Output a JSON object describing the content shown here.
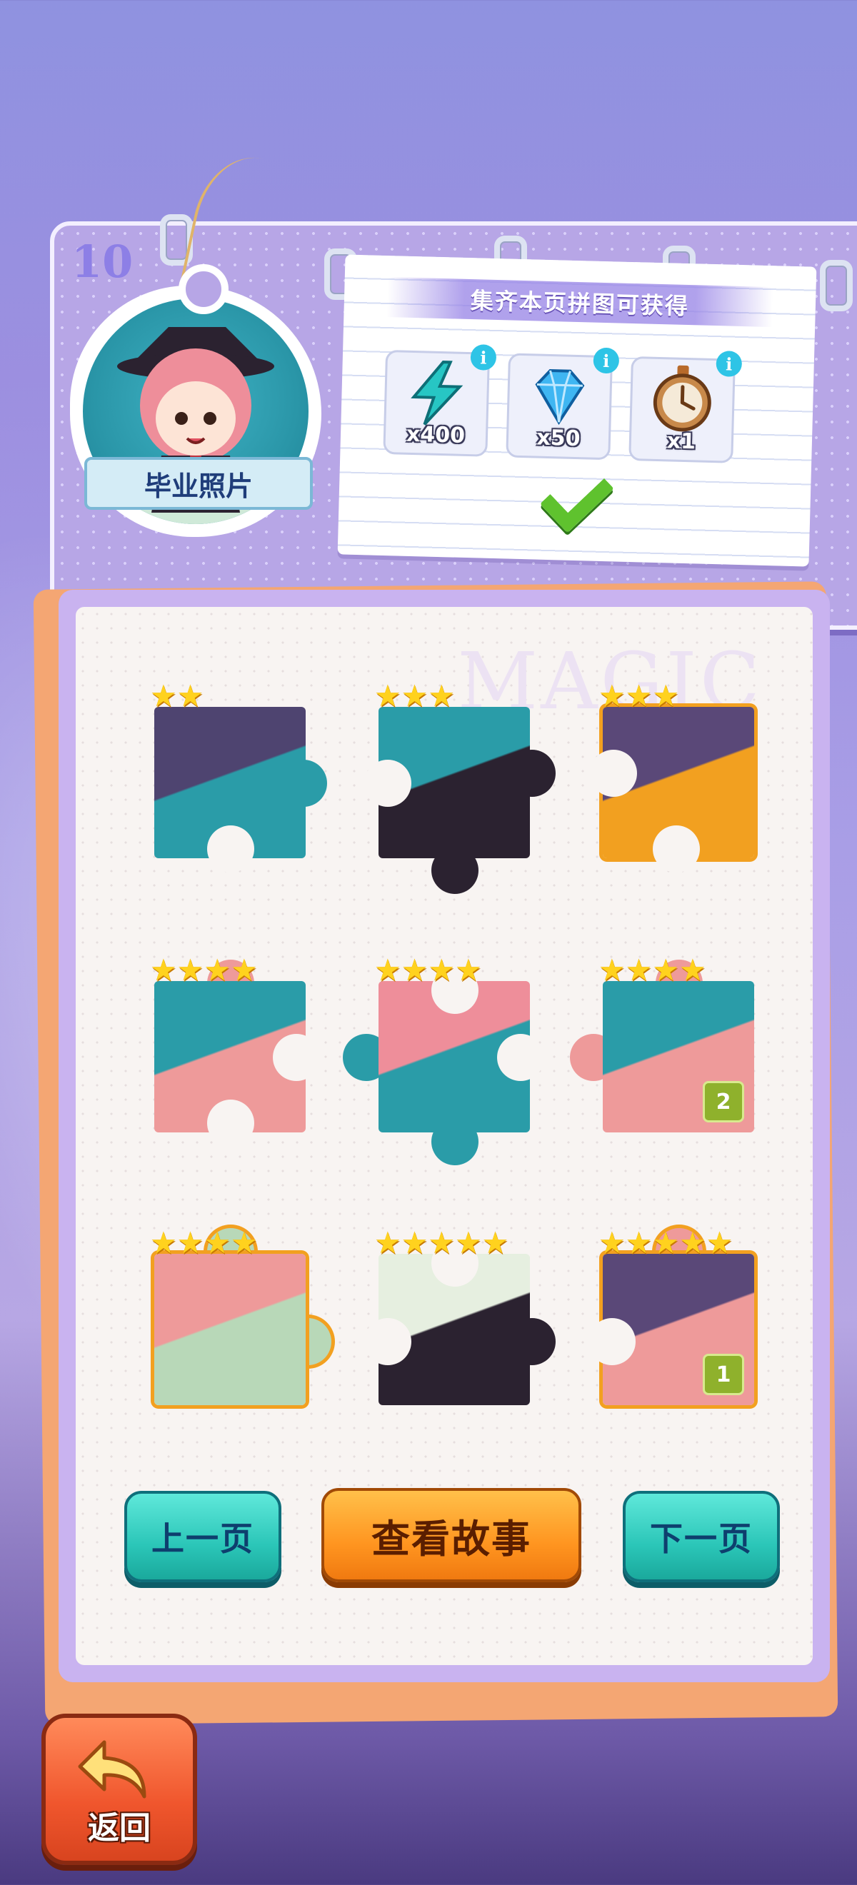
{
  "page": {
    "number": "10",
    "album_title": "毕业照片"
  },
  "reward": {
    "title": "集齐本页拼图可获得",
    "items": [
      {
        "icon": "lightning-icon",
        "count": "x400"
      },
      {
        "icon": "diamond-icon",
        "count": "x50"
      },
      {
        "icon": "stopwatch-icon",
        "count": "x1"
      }
    ],
    "claimed": true,
    "info_glyph": "i"
  },
  "board": {
    "watermark": "MAGIC"
  },
  "pieces": [
    {
      "stars": 2,
      "badge": null
    },
    {
      "stars": 3,
      "badge": null
    },
    {
      "stars": 3,
      "badge": null
    },
    {
      "stars": 4,
      "badge": null
    },
    {
      "stars": 4,
      "badge": null
    },
    {
      "stars": 4,
      "badge": "2"
    },
    {
      "stars": 4,
      "badge": null
    },
    {
      "stars": 5,
      "badge": null
    },
    {
      "stars": 5,
      "badge": "1"
    }
  ],
  "buttons": {
    "prev": "上一页",
    "story": "查看故事",
    "next": "下一页",
    "back": "返回"
  },
  "colors": {
    "teal": "#2bc6b8",
    "orange": "#ff9520",
    "star": "#ffd21e",
    "badge_green": "#8fb12c"
  }
}
